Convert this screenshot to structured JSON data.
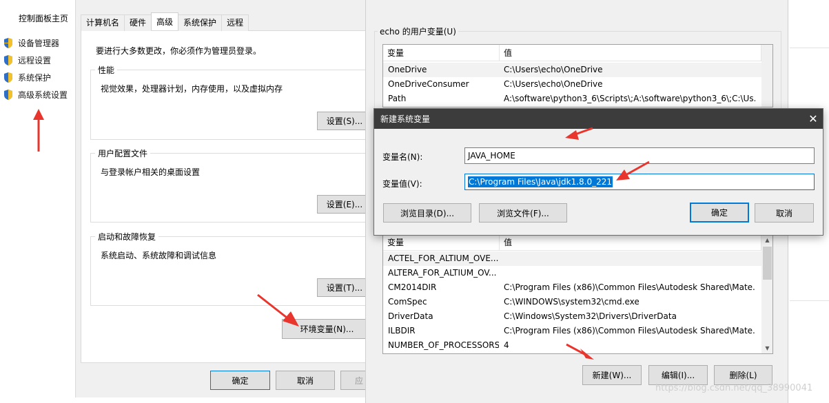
{
  "control_panel": {
    "home_label": "控制面板主页",
    "nav_items": [
      {
        "label": "设备管理器",
        "icon": "shield-icon"
      },
      {
        "label": "远程设置",
        "icon": "shield-icon"
      },
      {
        "label": "系统保护",
        "icon": "shield-icon"
      },
      {
        "label": "高级系统设置",
        "icon": "shield-icon"
      }
    ]
  },
  "system_properties": {
    "tabs": [
      "计算机名",
      "硬件",
      "高级",
      "系统保护",
      "远程"
    ],
    "active_tab": "高级",
    "admin_note": "要进行大多数更改，你必须作为管理员登录。",
    "performance": {
      "title": "性能",
      "desc": "视觉效果，处理器计划，内存使用，以及虚拟内存",
      "button": "设置(S)..."
    },
    "user_profiles": {
      "title": "用户配置文件",
      "desc": "与登录帐户相关的桌面设置",
      "button": "设置(E)..."
    },
    "startup_recovery": {
      "title": "启动和故障恢复",
      "desc": "系统启动、系统故障和调试信息",
      "button": "设置(T)..."
    },
    "env_button": "环境变量(N)...",
    "ok_button": "确定",
    "cancel_button": "取消",
    "apply_button": "应"
  },
  "env_vars": {
    "user_section_title": "echo 的用户变量(U)",
    "col_variable": "变量",
    "col_value": "值",
    "user_vars": [
      {
        "name": "OneDrive",
        "value": "C:\\Users\\echo\\OneDrive"
      },
      {
        "name": "OneDriveConsumer",
        "value": "C:\\Users\\echo\\OneDrive"
      },
      {
        "name": "Path",
        "value": "A:\\software\\python3_6\\Scripts\\;A:\\software\\python3_6\\;C:\\Us..."
      }
    ],
    "system_vars": [
      {
        "name": "ACTEL_FOR_ALTIUM_OVE...",
        "value": ""
      },
      {
        "name": "ALTERA_FOR_ALTIUM_OV...",
        "value": ""
      },
      {
        "name": "CM2014DIR",
        "value": "C:\\Program Files (x86)\\Common Files\\Autodesk Shared\\Mate..."
      },
      {
        "name": "ComSpec",
        "value": "C:\\WINDOWS\\system32\\cmd.exe"
      },
      {
        "name": "DriverData",
        "value": "C:\\Windows\\System32\\Drivers\\DriverData"
      },
      {
        "name": "ILBDIR",
        "value": "C:\\Program Files (x86)\\Common Files\\Autodesk Shared\\Mate..."
      },
      {
        "name": "NUMBER_OF_PROCESSORS",
        "value": "4"
      }
    ],
    "new_button": "新建(W)...",
    "edit_button": "编辑(I)...",
    "delete_button": "删除(L)"
  },
  "new_var_dialog": {
    "title": "新建系统变量",
    "name_label": "变量名(N):",
    "name_value": "JAVA_HOME",
    "value_label": "变量值(V):",
    "value_value": "C:\\Program Files\\Java\\jdk1.8.0_221",
    "browse_dir_button": "浏览目录(D)...",
    "browse_file_button": "浏览文件(F)...",
    "ok_button": "确定",
    "cancel_button": "取消",
    "close_icon": "close-icon"
  },
  "watermark": "https://blog.csdn.net/qq_38990041",
  "colors": {
    "accent": "#0078d7",
    "annotation_red": "#e8352e",
    "titlebar": "#3c3c3c"
  }
}
